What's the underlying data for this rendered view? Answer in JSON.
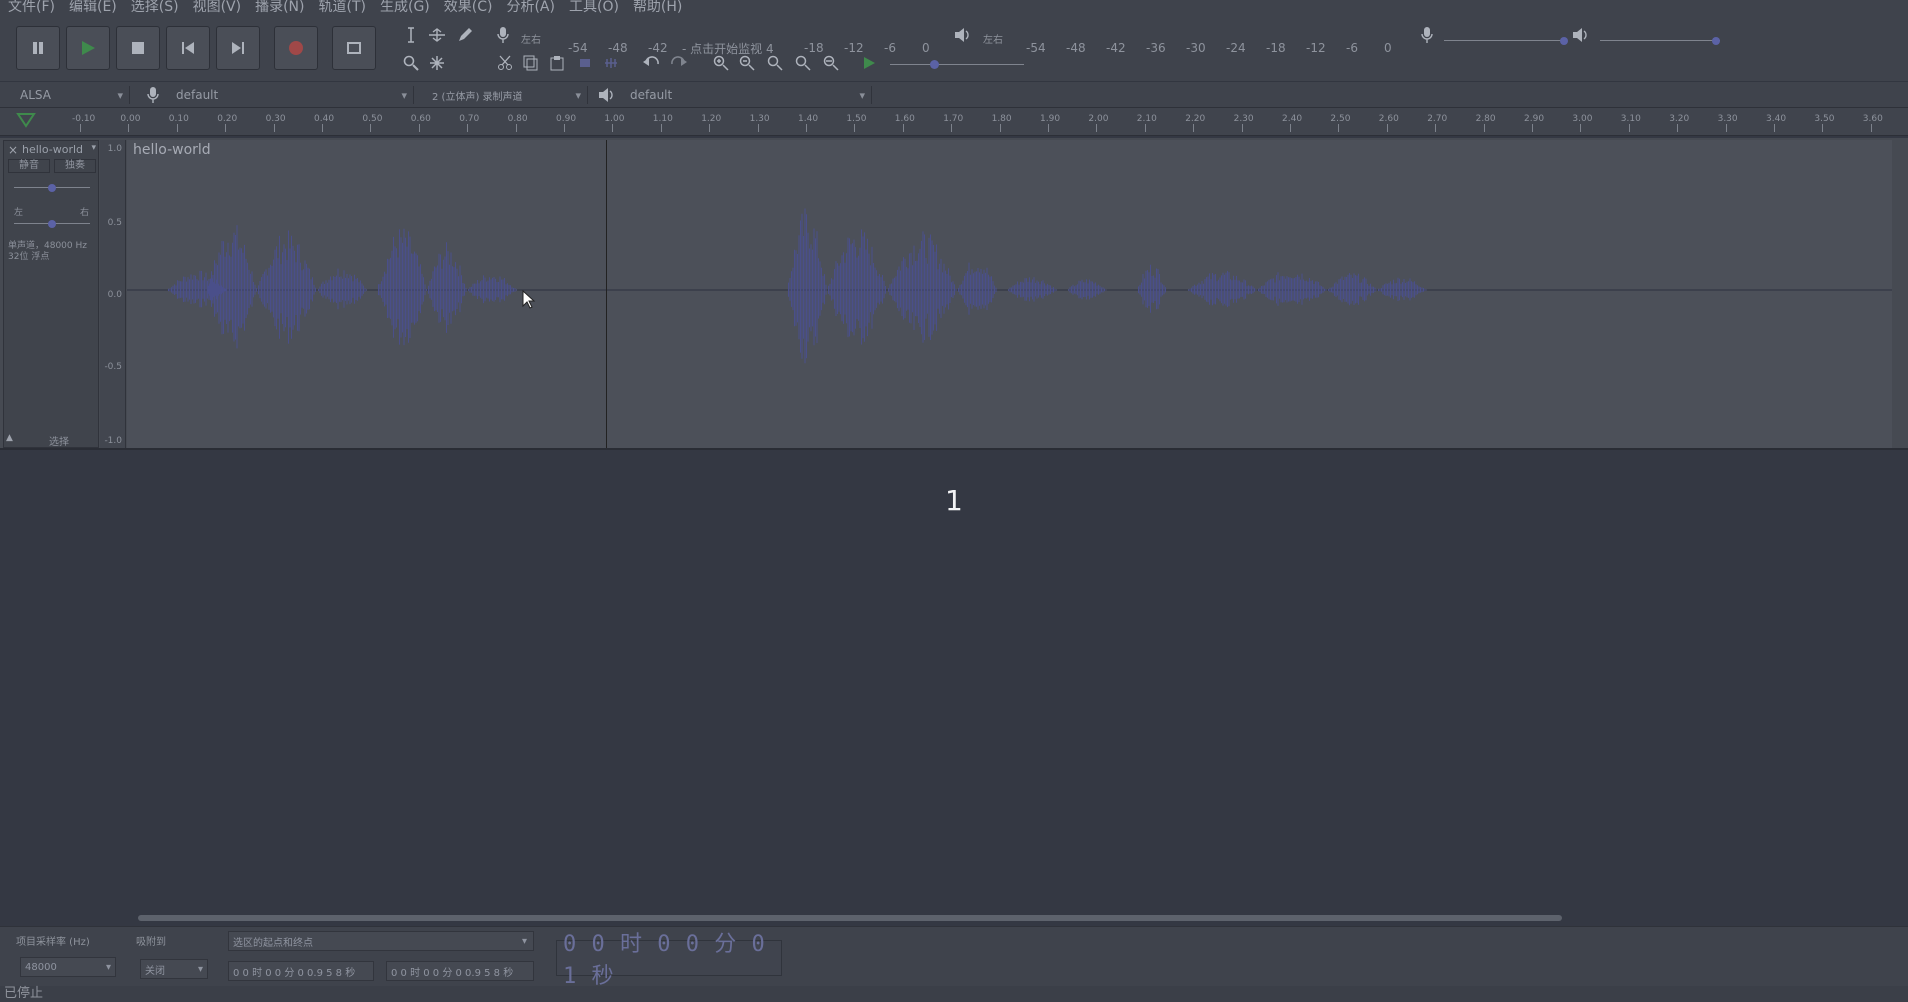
{
  "menu": [
    "文件(F)",
    "编辑(E)",
    "选择(S)",
    "视图(V)",
    "播录(N)",
    "轨道(T)",
    "生成(G)",
    "效果(C)",
    "分析(A)",
    "工具(O)",
    "帮助(H)"
  ],
  "meters": {
    "record_ticks": [
      "-54",
      "-48",
      "-42",
      "- 点击开始监视 4",
      "-18",
      "-12",
      "-6",
      "0"
    ],
    "play_ticks": [
      "-54",
      "-48",
      "-42",
      "-36",
      "-30",
      "-24",
      "-18",
      "-12",
      "-6",
      "0"
    ],
    "lr_label_rec": "左右",
    "lr_label_play": "左右"
  },
  "device": {
    "host": "ALSA",
    "input": "default",
    "channels": "2 (立体声) 录制声道",
    "output": "default"
  },
  "ruler": {
    "ticks": [
      "-0.10",
      "0.00",
      "0.10",
      "0.20",
      "0.30",
      "0.40",
      "0.50",
      "0.60",
      "0.70",
      "0.80",
      "0.90",
      "1.00",
      "1.10",
      "1.20",
      "1.30",
      "1.40",
      "1.50",
      "1.60",
      "1.70",
      "1.80",
      "1.90",
      "2.00",
      "2.10",
      "2.20",
      "2.30",
      "2.40",
      "2.50",
      "2.60",
      "2.70",
      "2.80",
      "2.90",
      "3.00",
      "3.10",
      "3.20",
      "3.30",
      "3.40",
      "3.50",
      "3.60"
    ]
  },
  "track": {
    "name": "hello-world",
    "clip_name": "hello-world",
    "mute": "静音",
    "solo": "独奏",
    "left": "左",
    "right": "右",
    "info": "单声道，48000 Hz\n32位 浮点",
    "select": "选择",
    "scale": [
      "1.0",
      "0.5",
      "0.0",
      "-0.5",
      "-1.0"
    ]
  },
  "overlay_number": "1",
  "selection_toolbar": {
    "rate_label": "项目采样率 (Hz)",
    "rate_value": "48000",
    "snap_label": "吸附到",
    "snap_value": "关闭",
    "mode_value": "选区的起点和终点",
    "start_time": "0 0 时 0 0 分 0 0.9 5 8 秒",
    "end_time": "0 0 时 0 0 分 0 0.9 5 8 秒",
    "big_time": "0 0 时 0 0 分 0 1 秒"
  },
  "status_text": "已停止",
  "colors": {
    "wave": "#4a4f8a",
    "record": "#a04848",
    "play": "#3f8a4c"
  }
}
